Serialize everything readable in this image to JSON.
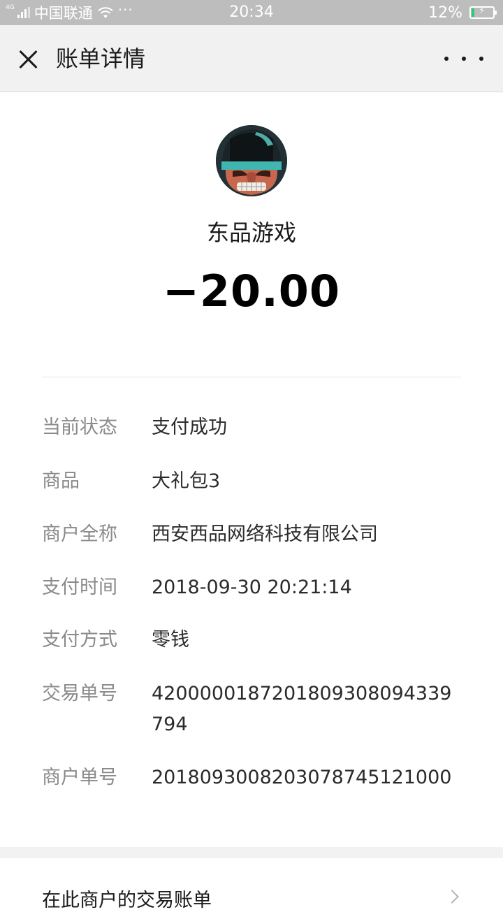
{
  "status_bar": {
    "network_type": "4G",
    "carrier": "中国联通",
    "more_indicator": "···",
    "time": "20:34",
    "battery_percent": "12%",
    "battery_level": 0.12
  },
  "nav": {
    "title": "账单详情"
  },
  "header": {
    "merchant_name": "东品游戏",
    "amount": "−20.00"
  },
  "details": [
    {
      "label": "当前状态",
      "value": "支付成功"
    },
    {
      "label": "商品",
      "value": "大礼包3"
    },
    {
      "label": "商户全称",
      "value": "西安西品网络科技有限公司"
    },
    {
      "label": "支付时间",
      "value": "2018-09-30 20:21:14"
    },
    {
      "label": "支付方式",
      "value": "零钱"
    },
    {
      "label": "交易单号",
      "value": "4200000187201809308094339794"
    },
    {
      "label": "商户单号",
      "value": "2018093008203078745121000"
    }
  ],
  "bottom": {
    "link_label": "在此商户的交易账单"
  },
  "colors": {
    "status_bar_bg": "#bdbdbd",
    "nav_bg": "#f1f1f1",
    "label_gray": "#8a8a8a",
    "battery_green": "#2ecc71"
  }
}
